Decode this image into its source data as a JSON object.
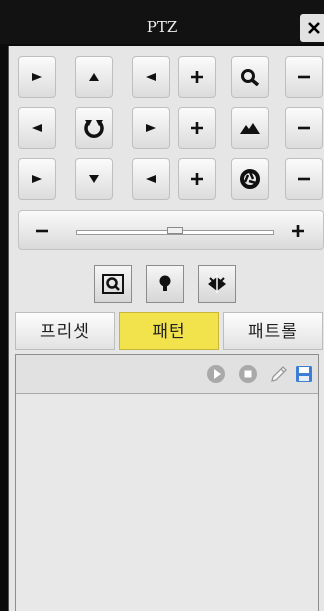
{
  "window": {
    "title": "PTZ"
  },
  "tabs": [
    {
      "label": "프리셋",
      "active": false
    },
    {
      "label": "패턴",
      "active": true
    },
    {
      "label": "패트롤",
      "active": false
    }
  ],
  "colors": {
    "active_tab": "#f2e34c",
    "window_bg": "#0b0b0b",
    "panel_bg": "#e6e6e6"
  },
  "icons": {
    "controls": [
      "arrow-up-left-icon",
      "arrow-up-icon",
      "arrow-up-right-icon",
      "plus-icon",
      "zoom-icon",
      "minus-icon",
      "arrow-left-icon",
      "home-reset-icon",
      "arrow-right-icon",
      "plus-icon",
      "focus-icon",
      "minus-icon",
      "arrow-down-left-icon",
      "arrow-down-icon",
      "arrow-down-right-icon",
      "plus-icon",
      "iris-icon",
      "minus-icon"
    ],
    "modes": [
      "zoom-frame-icon",
      "light-icon",
      "wiper-icon"
    ],
    "tools": [
      "play-icon",
      "stop-icon",
      "edit-icon",
      "save-icon"
    ]
  }
}
